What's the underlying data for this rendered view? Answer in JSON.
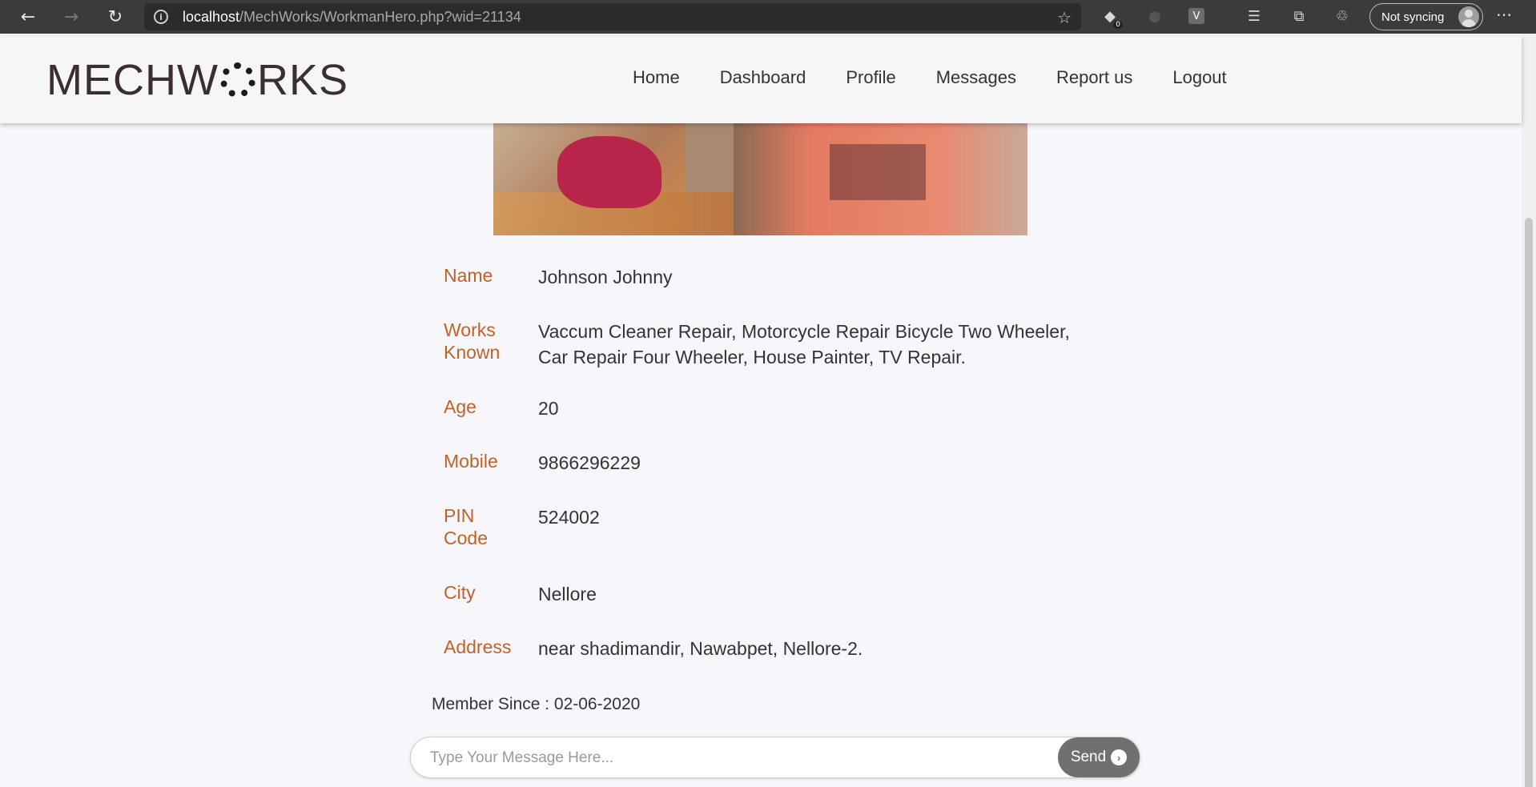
{
  "browser": {
    "url_host": "localhost",
    "url_path": "/MechWorks/WorkmanHero.php?wid=21134",
    "sync_label": "Not syncing",
    "ext_badge": "0",
    "ext_v": "V"
  },
  "site": {
    "logo_left": "MECHW",
    "logo_right": "RKS",
    "nav": [
      "Home",
      "Dashboard",
      "Profile",
      "Messages",
      "Report us",
      "Logout"
    ]
  },
  "profile": {
    "name_label": "Name",
    "name": "Johnson Johnny",
    "works_label_1": "Works",
    "works_label_2": "Known",
    "works_line_1": "Vaccum Cleaner Repair, Motorcycle Repair Bicycle Two Wheeler,",
    "works_line_2": "Car Repair Four Wheeler, House Painter, TV Repair.",
    "age_label": "Age",
    "age": "20",
    "mobile_label": "Mobile",
    "mobile": "9866296229",
    "pin_label_1": "PIN",
    "pin_label_2": "Code",
    "pin": "524002",
    "city_label": "City",
    "city": "Nellore",
    "address_label": "Address",
    "address": "near shadimandir, Nawabpet, Nellore-2.",
    "member_since": "Member Since : 02-06-2020"
  },
  "message": {
    "placeholder": "Type Your Message Here...",
    "send_label": "Send"
  }
}
